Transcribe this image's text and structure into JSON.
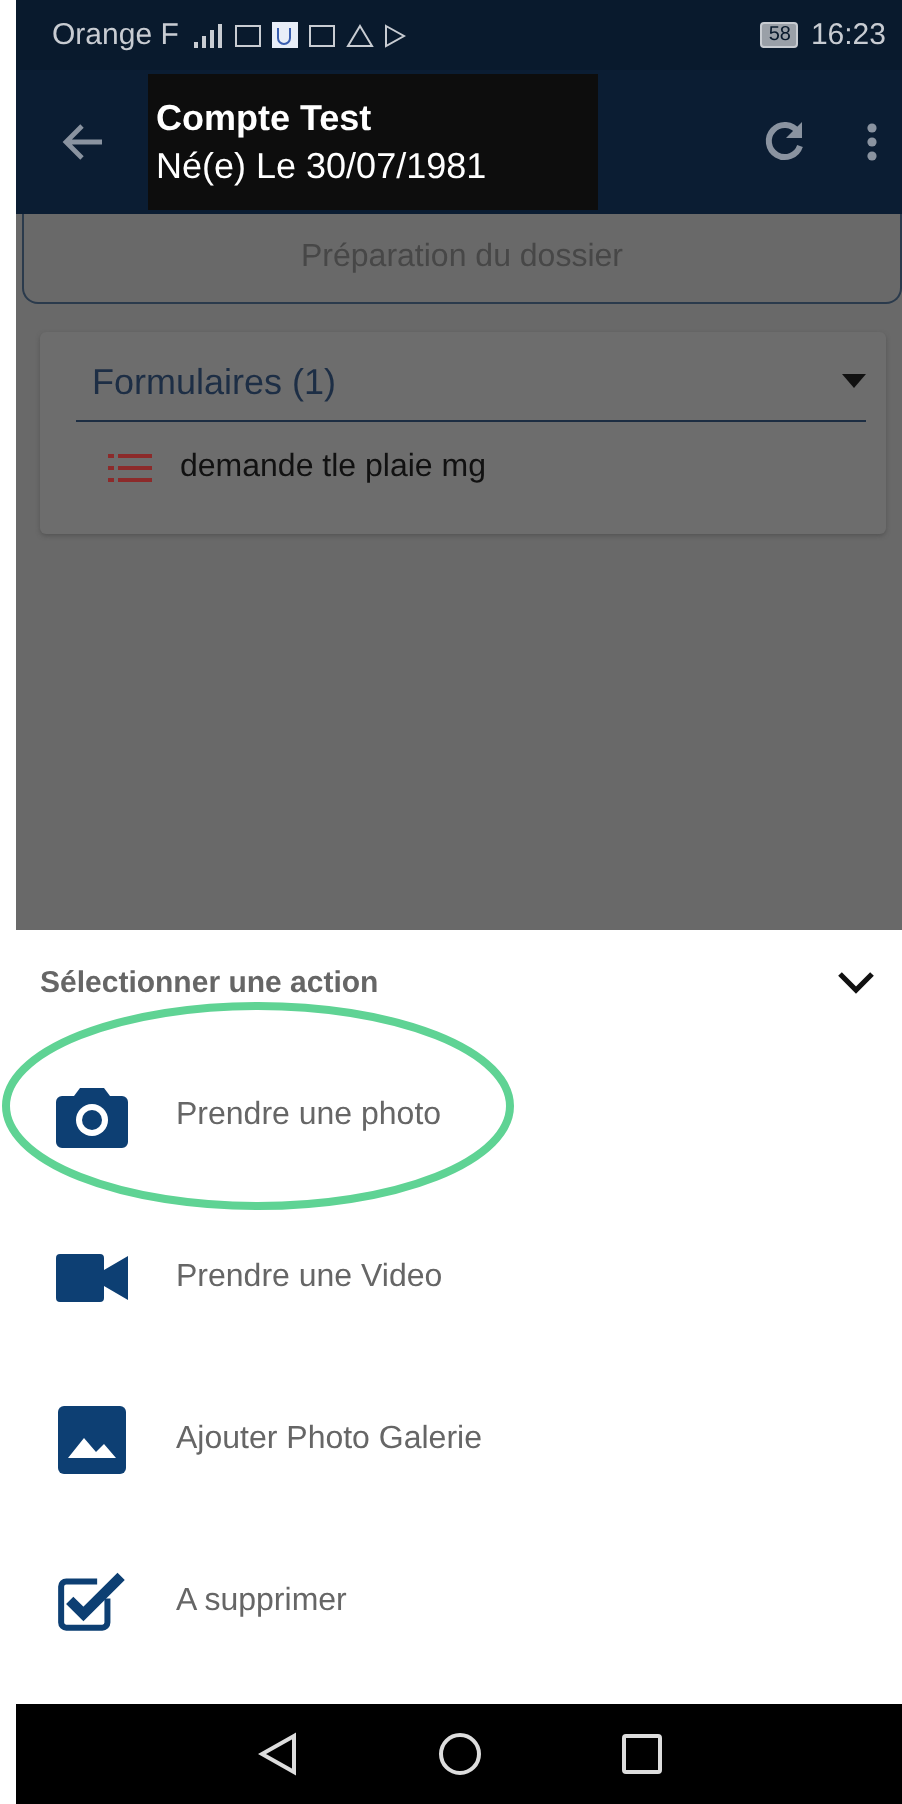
{
  "status_bar": {
    "carrier": "Orange F",
    "battery": "58",
    "time": "16:23"
  },
  "app_bar": {
    "title": "Compte Test",
    "subtitle": "Né(e) Le 30/07/1981"
  },
  "content": {
    "section_button": "Préparation du dossier",
    "forms": {
      "title": "Formulaires (1)",
      "expanded": true,
      "items": [
        "demande tle plaie mg"
      ]
    }
  },
  "action_sheet": {
    "title": "Sélectionner une action",
    "actions": [
      {
        "kind": "camera",
        "label": "Prendre une photo",
        "highlighted": true
      },
      {
        "kind": "video",
        "label": "Prendre une Video",
        "highlighted": false
      },
      {
        "kind": "gallery",
        "label": "Ajouter Photo Galerie",
        "highlighted": false
      },
      {
        "kind": "checkbox",
        "label": "A supprimer",
        "highlighted": false
      }
    ]
  }
}
